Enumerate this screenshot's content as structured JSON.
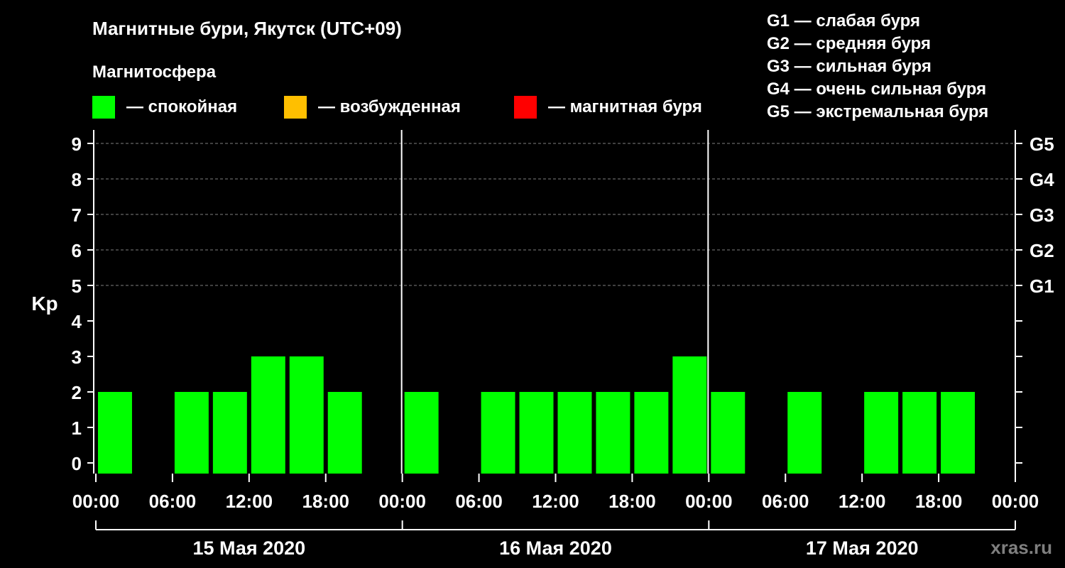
{
  "header": {
    "title": "Магнитные бури, Якутск (UTC+09)",
    "subtitle": "Магнитосфера"
  },
  "legend": {
    "items": [
      {
        "label": "— спокойная",
        "color": "#00ff00"
      },
      {
        "label": "— возбужденная",
        "color": "#ffbf00"
      },
      {
        "label": "— магнитная буря",
        "color": "#ff0000"
      }
    ]
  },
  "storm_levels": [
    "G1 — слабая буря",
    "G2 — средняя буря",
    "G3 — сильная буря",
    "G4 — очень сильная буря",
    "G5 — экстремальная буря"
  ],
  "watermark": "xras.ru",
  "chart_data": {
    "type": "bar",
    "ylabel": "Kp",
    "ylim": [
      0,
      9
    ],
    "y_ticks": [
      0,
      1,
      2,
      3,
      4,
      5,
      6,
      7,
      8,
      9
    ],
    "right_axis_labels": [
      {
        "value": 5,
        "label": "G1"
      },
      {
        "value": 6,
        "label": "G2"
      },
      {
        "value": 7,
        "label": "G3"
      },
      {
        "value": 8,
        "label": "G4"
      },
      {
        "value": 9,
        "label": "G5"
      }
    ],
    "x_tick_labels": [
      "00:00",
      "06:00",
      "12:00",
      "18:00",
      "00:00",
      "06:00",
      "12:00",
      "18:00",
      "00:00",
      "06:00",
      "12:00",
      "18:00",
      "00:00"
    ],
    "days": [
      "15 Мая 2020",
      "16 Мая 2020",
      "17 Мая 2020"
    ],
    "interval_hours": 3,
    "categories": [
      "15 Мая 2020 00:00",
      "15 Мая 2020 03:00",
      "15 Мая 2020 06:00",
      "15 Мая 2020 09:00",
      "15 Мая 2020 12:00",
      "15 Мая 2020 15:00",
      "15 Мая 2020 18:00",
      "15 Мая 2020 21:00",
      "16 Мая 2020 00:00",
      "16 Мая 2020 03:00",
      "16 Мая 2020 06:00",
      "16 Мая 2020 09:00",
      "16 Мая 2020 12:00",
      "16 Мая 2020 15:00",
      "16 Мая 2020 18:00",
      "16 Мая 2020 21:00",
      "17 Мая 2020 00:00",
      "17 Мая 2020 03:00",
      "17 Мая 2020 06:00",
      "17 Мая 2020 09:00",
      "17 Мая 2020 12:00",
      "17 Мая 2020 15:00",
      "17 Мая 2020 18:00",
      "17 Мая 2020 21:00"
    ],
    "values": [
      1,
      null,
      1,
      1,
      2,
      2,
      1,
      null,
      1,
      null,
      1,
      1,
      1,
      1,
      1,
      2,
      1,
      null,
      1,
      null,
      1,
      1,
      1,
      null
    ],
    "grid": "dashed horizontal",
    "bar_color": "#00ff00"
  }
}
